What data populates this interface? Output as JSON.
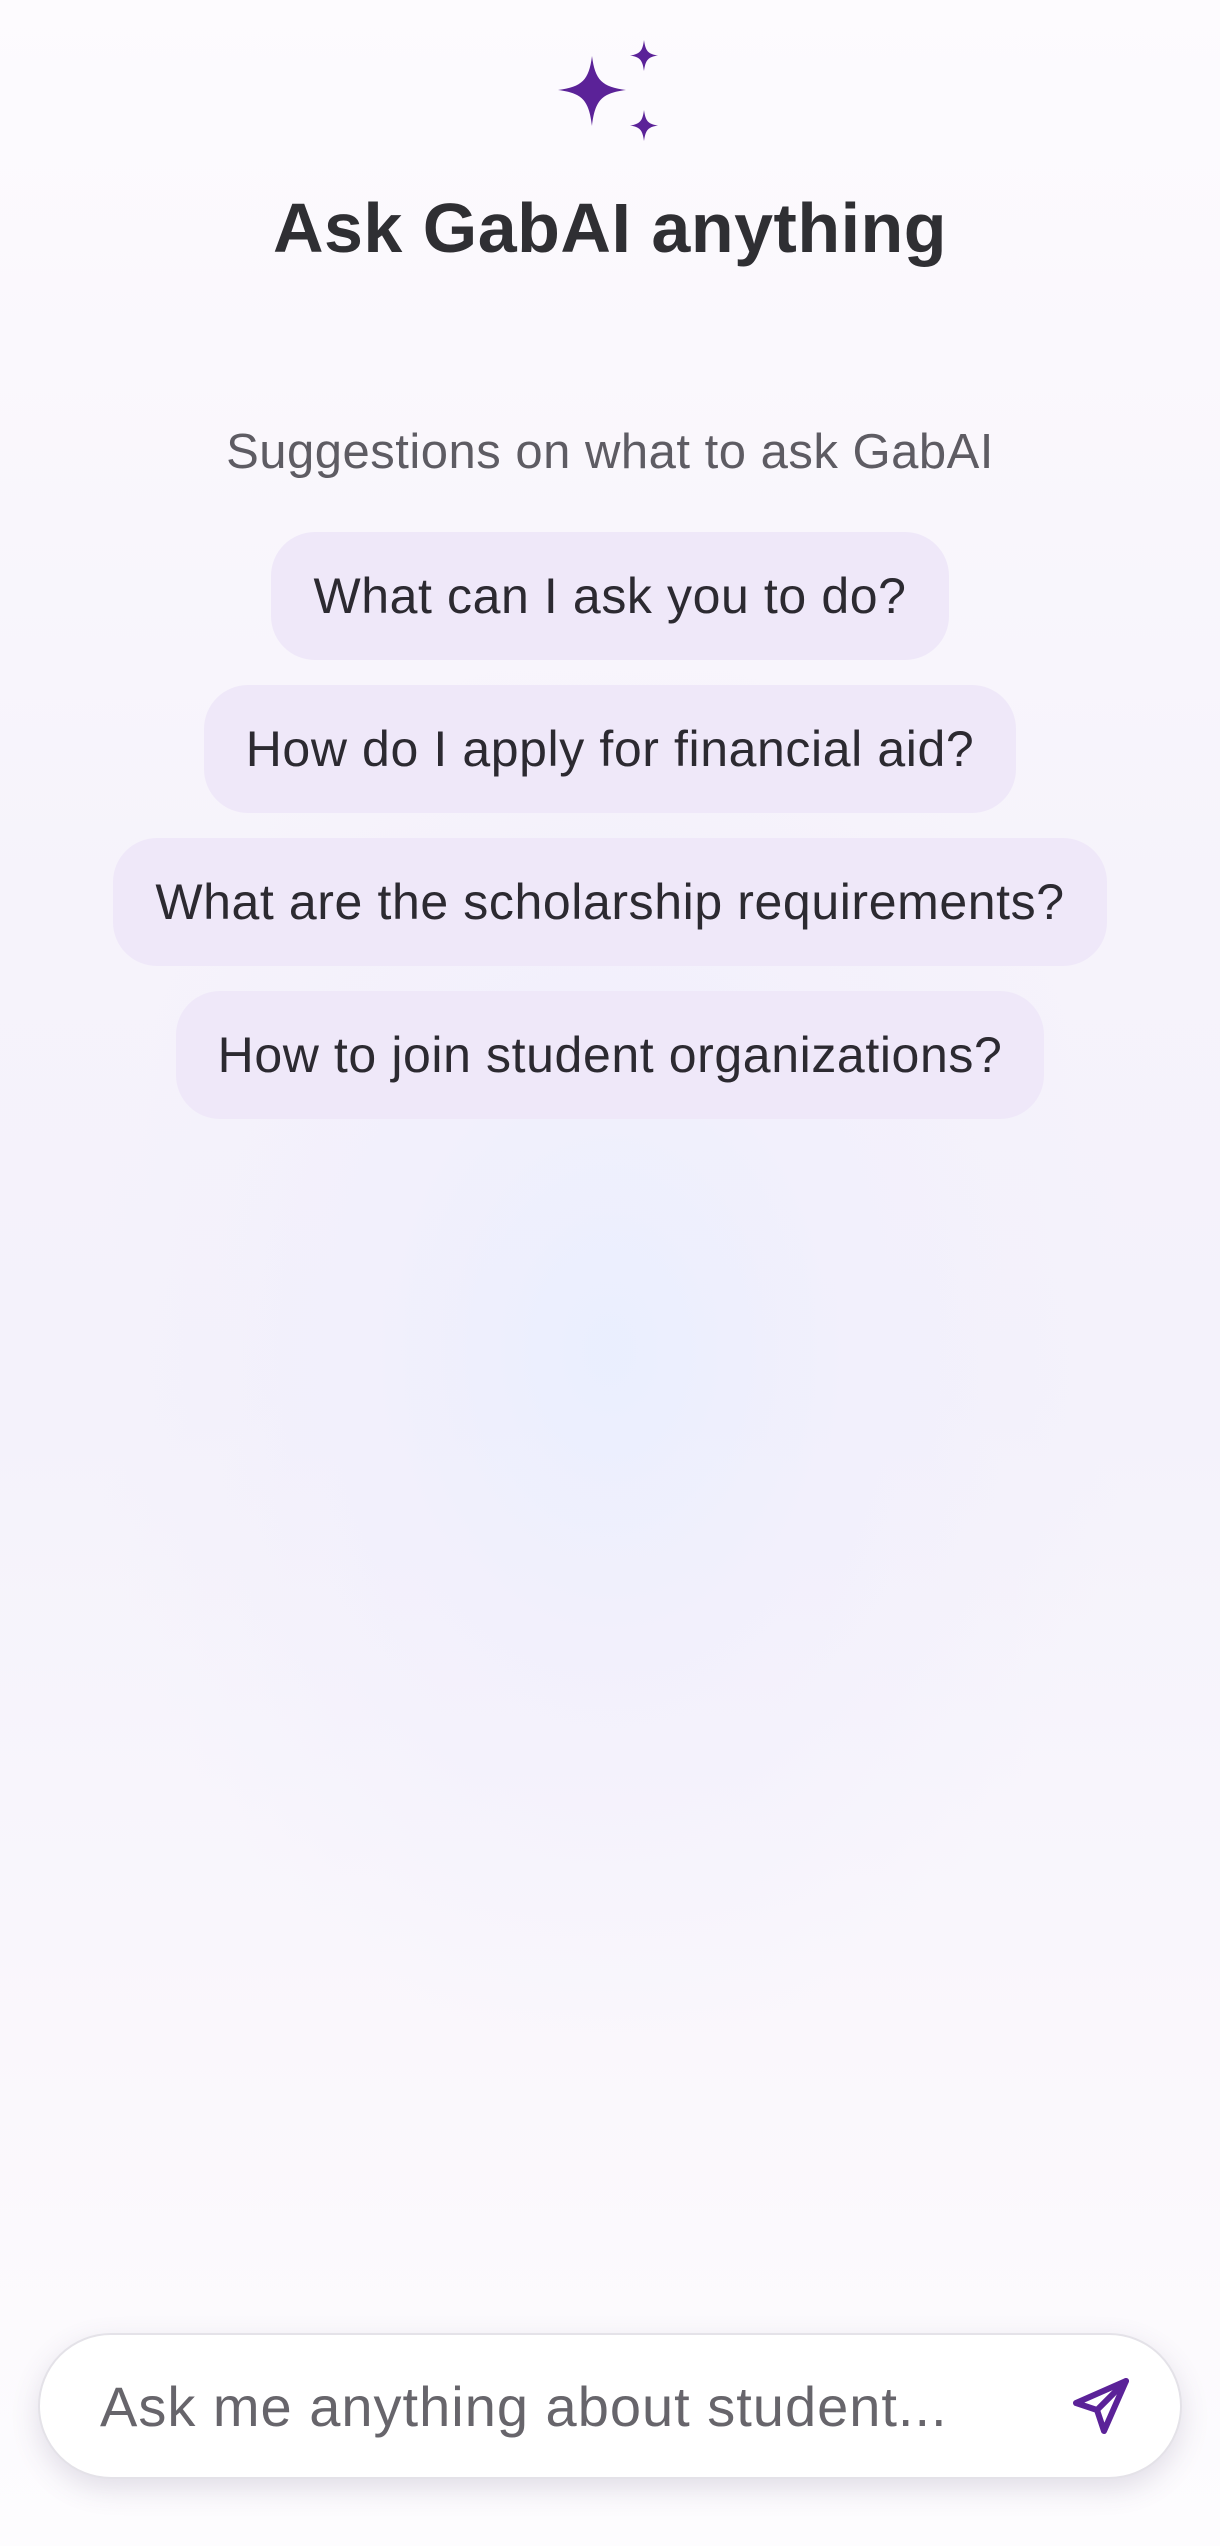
{
  "header": {
    "icon": "sparkles-icon",
    "title": "Ask GabAI anything"
  },
  "suggestions": {
    "heading": "Suggestions on what to ask GabAI",
    "items": [
      {
        "label": "What can I ask you to do?"
      },
      {
        "label": "How do I apply for financial aid?"
      },
      {
        "label": "What are the scholarship requirements?"
      },
      {
        "label": "How to join student organizations?"
      }
    ]
  },
  "composer": {
    "placeholder": "Ask me anything about student...",
    "value": "",
    "send_icon": "send-icon"
  },
  "colors": {
    "accent": "#5b2298",
    "chip_background": "#efe8f9",
    "title_text": "#2f2f33",
    "secondary_text": "#5e5c63"
  }
}
